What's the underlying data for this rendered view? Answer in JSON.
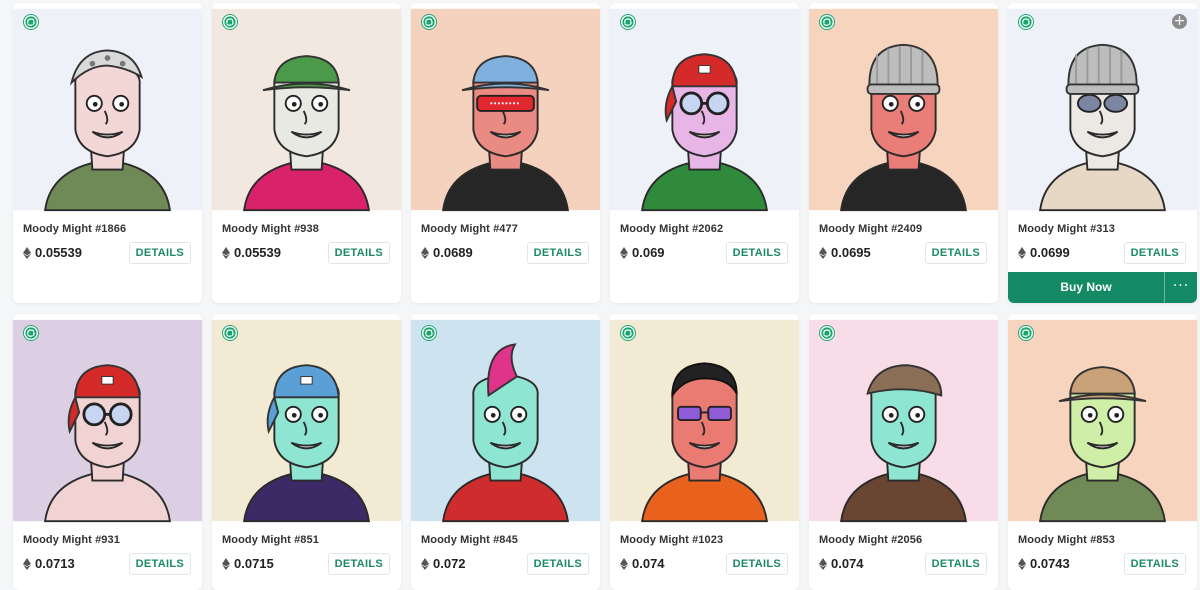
{
  "buy_label": "Buy Now",
  "more_label": "···",
  "details_label": "DETAILS",
  "add_label": "+",
  "accent": "#138a63",
  "marketplace_icon": "marketplace-logo-icon",
  "currency_icon": "eth-icon",
  "cards": [
    {
      "name": "Moody Might #1866",
      "price": "0.05539",
      "bg": "#eef1f7",
      "skin": "#f3d6d6",
      "hat": "bandana",
      "hat_color": "#d9d9d9",
      "shirt": "#6f8a57",
      "glasses": "none"
    },
    {
      "name": "Moody Might #938",
      "price": "0.05539",
      "bg": "#f3e8df",
      "skin": "#e9e9e3",
      "hat": "bucket",
      "hat_color": "#4a9a4a",
      "shirt": "#d8236b",
      "glasses": "none"
    },
    {
      "name": "Moody Might #477",
      "price": "0.0689",
      "bg": "#f5d2be",
      "skin": "#e98b82",
      "hat": "bucket",
      "hat_color": "#7fb0de",
      "shirt": "#262626",
      "glasses": "visor"
    },
    {
      "name": "Moody Might #2062",
      "price": "0.069",
      "bg": "#eef1f7",
      "skin": "#e8b6e6",
      "hat": "cap",
      "hat_color": "#d42a2a",
      "shirt": "#2f8a3b",
      "glasses": "round"
    },
    {
      "name": "Moody Might #2409",
      "price": "0.0695",
      "bg": "#f7d4be",
      "skin": "#ea7d77",
      "hat": "beanie",
      "hat_color": "#bdbdbd",
      "shirt": "#262626",
      "glasses": "none"
    },
    {
      "name": "Moody Might #313",
      "price": "0.0699",
      "bg": "#eef1f7",
      "skin": "#ece9e4",
      "hat": "beanie",
      "hat_color": "#bdbdbd",
      "shirt": "#e6d8c4",
      "glasses": "shades",
      "buy": true
    },
    {
      "name": "Moody Might #931",
      "price": "0.0713",
      "bg": "#dccfe3",
      "skin": "#f2d3d3",
      "hat": "cap",
      "hat_color": "#d42a2a",
      "shirt": "#f2d3d3",
      "glasses": "round"
    },
    {
      "name": "Moody Might #851",
      "price": "0.0715",
      "bg": "#f2ead2",
      "skin": "#8ee6d2",
      "hat": "cap",
      "hat_color": "#5a9fd6",
      "shirt": "#3c2a66",
      "glasses": "none"
    },
    {
      "name": "Moody Might #845",
      "price": "0.072",
      "bg": "#cde3f0",
      "skin": "#8ee6d2",
      "hat": "mohawk",
      "hat_color": "#e0338a",
      "shirt": "#cf2d2d",
      "glasses": "none"
    },
    {
      "name": "Moody Might #1023",
      "price": "0.074",
      "bg": "#f2ead2",
      "skin": "#e97b73",
      "hat": "hair",
      "hat_color": "#222222",
      "shirt": "#e8621e",
      "glasses": "purple"
    },
    {
      "name": "Moody Might #2056",
      "price": "0.074",
      "bg": "#f8dce8",
      "skin": "#8ee6d2",
      "hat": "flatcap",
      "hat_color": "#8a6e55",
      "shirt": "#6a4532",
      "glasses": "none"
    },
    {
      "name": "Moody Might #853",
      "price": "0.0743",
      "bg": "#f7d4be",
      "skin": "#cfeea8",
      "hat": "bucket",
      "hat_color": "#c9a27a",
      "shirt": "#6f8a57",
      "glasses": "none"
    }
  ]
}
